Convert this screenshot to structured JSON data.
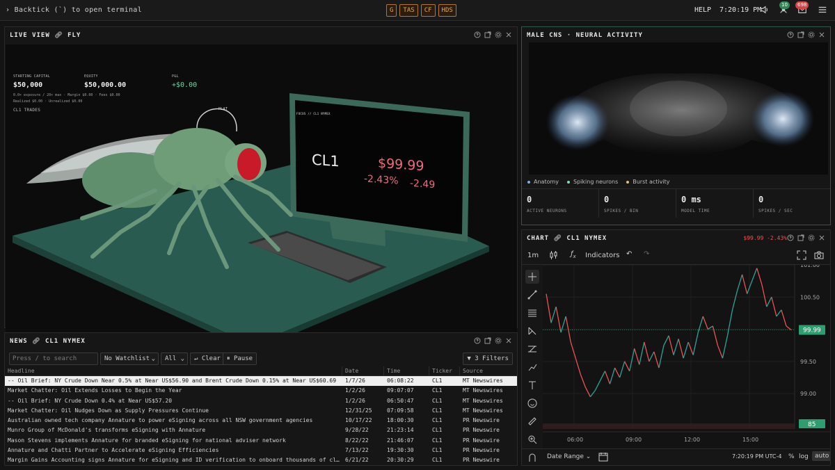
{
  "topbar": {
    "terminal_hint": "› Backtick (`) to open terminal",
    "fn_keys": [
      "G",
      "TAS",
      "CF",
      "HDS"
    ],
    "help": "HELP",
    "clock": "7:20:19 PM",
    "badge_green": "10",
    "badge_red": "698",
    "colors": {
      "accent_orange": "#e5a55a",
      "badge_green": "#2e8b57",
      "badge_red": "#d64545"
    }
  },
  "live_view": {
    "title": "LIVE VIEW",
    "link_label": "FLY",
    "starting_capital_label": "STARTING CAPITAL",
    "starting_capital": "$50,000",
    "equity_label": "EQUITY",
    "equity": "$50,000.00",
    "pnl_label": "P&L",
    "pnl": "+$0.00",
    "exposure_line": "0.0× exposure / 20× max · Margin $0.00 · Fees $0.00",
    "realized_line": "Realized $0.00 · Unrealized $0.00",
    "trades_label": "CL1 TRADES",
    "sign_label": "PLAT",
    "monitor": {
      "header": "FOCUS // CL1 NYMEX",
      "symbol": "CL1",
      "price": "$99.99",
      "change_pct": "-2.43%",
      "change_abs": "-2.49"
    }
  },
  "neural": {
    "title": "MALE CNS · NEURAL ACTIVITY",
    "legend": [
      {
        "label": "Anatomy",
        "color": "#7fb0e0"
      },
      {
        "label": "Spiking neurons",
        "color": "#7fe0b0"
      },
      {
        "label": "Burst activity",
        "color": "#e0c07f"
      }
    ],
    "metrics": [
      {
        "value": "0",
        "label": "ACTIVE NEURONS"
      },
      {
        "value": "0",
        "label": "SPIKES / BIN"
      },
      {
        "value": "0 ms",
        "label": "MODEL TIME"
      },
      {
        "value": "0",
        "label": "SPIKES / SEC"
      }
    ]
  },
  "news": {
    "title": "NEWS",
    "link_label": "CL1 NYMEX",
    "search_placeholder": "Press / to search",
    "watchlist": "No Watchlist",
    "filter_all": "All",
    "clear_label": "Clear",
    "pause_label": "Pause",
    "filters_label": "3 Filters",
    "columns": [
      "Headline",
      "Date",
      "Time",
      "Ticker",
      "Source"
    ],
    "rows": [
      [
        "-- Oil Brief: NY Crude Down Near 0.5% at Near US$56.90 and Brent Crude Down 0.15% at Near US$60.69",
        "1/7/26",
        "06:08:22",
        "CL1",
        "MT Newswires"
      ],
      [
        "Market Chatter: Oil Extends Losses to Begin the Year",
        "1/2/26",
        "09:07:07",
        "CL1",
        "MT Newswires"
      ],
      [
        "-- Oil Brief: NY Crude Down 0.4% at Near US$57.20",
        "1/2/26",
        "06:50:47",
        "CL1",
        "MT Newswires"
      ],
      [
        "Market Chatter: Oil Nudges Down as Supply Pressures Continue",
        "12/31/25",
        "07:09:58",
        "CL1",
        "MT Newswires"
      ],
      [
        "Australian owned tech company Annature to power eSigning across all NSW government agencies",
        "10/17/22",
        "18:00:30",
        "CL1",
        "PR Newswire"
      ],
      [
        "Munro Group of McDonald's transforms eSigning with Annature",
        "9/28/22",
        "21:23:14",
        "CL1",
        "PR Newswire"
      ],
      [
        "Mason Stevens implements Annature for branded eSigning for national adviser network",
        "8/22/22",
        "21:46:07",
        "CL1",
        "PR Newswire"
      ],
      [
        "Annature and Chatti Partner to Accelerate eSigning Efficiencies",
        "7/13/22",
        "19:30:30",
        "CL1",
        "PR Newswire"
      ],
      [
        "Margin Gains Accounting signs Annature for eSigning and ID verification to onboard thousands of clients",
        "6/21/22",
        "20:30:29",
        "CL1",
        "PR Newswire"
      ]
    ]
  },
  "chart_panel": {
    "title": "CHART",
    "link_label": "CL1 NYMEX",
    "header_quote": "$99.99 -2.43%",
    "interval": "1m",
    "indicators_label": "Indicators",
    "date_range_label": "Date Range",
    "footer_time": "7:20:19 PM UTC-4",
    "pct_label": "%",
    "log_label": "log",
    "auto_label": "auto",
    "colors": {
      "up": "#26a69a",
      "down": "#ef5350",
      "last_price_tag": "#2f9e6e"
    }
  },
  "chart_data": {
    "type": "line",
    "title": "",
    "xlabel": "",
    "ylabel": "",
    "x_ticks": [
      "06:00",
      "09:00",
      "12:00",
      "15:00"
    ],
    "y_ticks": [
      "101.00",
      "100.50",
      "100.00",
      "99.50",
      "99.00",
      "98.50"
    ],
    "ylim": [
      98.45,
      101.0
    ],
    "last_price": "99.99",
    "volume_tag": "85",
    "series": [
      {
        "values": [
          100.55,
          100.1,
          100.35,
          99.95,
          100.2,
          99.8,
          99.55,
          99.3,
          99.1,
          98.95,
          99.05,
          99.2,
          99.35,
          99.15,
          99.4,
          99.25,
          99.5,
          99.35,
          99.7,
          99.45,
          99.8,
          99.5,
          99.65,
          99.4,
          99.75,
          99.9,
          99.6,
          99.85,
          99.55,
          99.8,
          99.6,
          99.95,
          100.2,
          100.0,
          100.05,
          99.75,
          99.55,
          99.9,
          100.3,
          100.6,
          100.85,
          100.55,
          100.75,
          100.95,
          100.7,
          100.35,
          100.5,
          100.2,
          100.3,
          100.05,
          99.99
        ]
      }
    ]
  }
}
